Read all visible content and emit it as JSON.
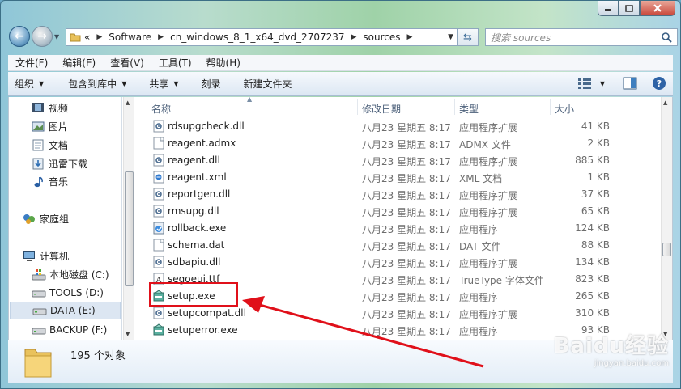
{
  "address": {
    "overflow": "«",
    "segments": [
      "Software",
      "cn_windows_8_1_x64_dvd_2707237",
      "sources"
    ]
  },
  "search": {
    "placeholder": "搜索 sources"
  },
  "menu": [
    "文件(F)",
    "编辑(E)",
    "查看(V)",
    "工具(T)",
    "帮助(H)"
  ],
  "toolbar": {
    "organize": "组织",
    "include": "包含到库中",
    "share": "共享",
    "burn": "刻录",
    "new_folder": "新建文件夹"
  },
  "nav": {
    "items": [
      {
        "label": "视频",
        "icon": "video-library-icon"
      },
      {
        "label": "图片",
        "icon": "pictures-library-icon"
      },
      {
        "label": "文档",
        "icon": "documents-library-icon"
      },
      {
        "label": "迅雷下载",
        "icon": "downloads-library-icon"
      },
      {
        "label": "音乐",
        "icon": "music-library-icon"
      },
      {
        "label": "家庭组",
        "icon": "homegroup-icon"
      },
      {
        "label": "计算机",
        "icon": "computer-icon"
      },
      {
        "label": "本地磁盘 (C:)",
        "icon": "system-drive-icon"
      },
      {
        "label": "TOOLS (D:)",
        "icon": "drive-icon"
      },
      {
        "label": "DATA (E:)",
        "icon": "drive-icon"
      },
      {
        "label": "BACKUP (F:)",
        "icon": "drive-icon"
      }
    ]
  },
  "columns": {
    "name": "名称",
    "date": "修改日期",
    "type": "类型",
    "size": "大小"
  },
  "files": [
    {
      "name": "rdsupgcheck.dll",
      "date": "八月23 星期五 8:17",
      "type": "应用程序扩展",
      "size": "41 KB",
      "icon": "dll-icon"
    },
    {
      "name": "reagent.admx",
      "date": "八月23 星期五 8:17",
      "type": "ADMX 文件",
      "size": "2 KB",
      "icon": "file-icon"
    },
    {
      "name": "reagent.dll",
      "date": "八月23 星期五 8:17",
      "type": "应用程序扩展",
      "size": "885 KB",
      "icon": "dll-icon"
    },
    {
      "name": "reagent.xml",
      "date": "八月23 星期五 8:17",
      "type": "XML 文档",
      "size": "1 KB",
      "icon": "xml-icon"
    },
    {
      "name": "reportgen.dll",
      "date": "八月23 星期五 8:17",
      "type": "应用程序扩展",
      "size": "37 KB",
      "icon": "dll-icon"
    },
    {
      "name": "rmsupg.dll",
      "date": "八月23 星期五 8:17",
      "type": "应用程序扩展",
      "size": "65 KB",
      "icon": "dll-icon"
    },
    {
      "name": "rollback.exe",
      "date": "八月23 星期五 8:17",
      "type": "应用程序",
      "size": "124 KB",
      "icon": "exe-icon"
    },
    {
      "name": "schema.dat",
      "date": "八月23 星期五 8:17",
      "type": "DAT 文件",
      "size": "88 KB",
      "icon": "file-icon"
    },
    {
      "name": "sdbapiu.dll",
      "date": "八月23 星期五 8:17",
      "type": "应用程序扩展",
      "size": "134 KB",
      "icon": "dll-icon"
    },
    {
      "name": "segoeui.ttf",
      "date": "八月23 星期五 8:17",
      "type": "TrueType 字体文件",
      "size": "823 KB",
      "icon": "font-icon"
    },
    {
      "name": "setup.exe",
      "date": "八月23 星期五 8:17",
      "type": "应用程序",
      "size": "265 KB",
      "icon": "setup-icon"
    },
    {
      "name": "setupcompat.dll",
      "date": "八月23 星期五 8:17",
      "type": "应用程序扩展",
      "size": "310 KB",
      "icon": "dll-icon"
    },
    {
      "name": "setuperror.exe",
      "date": "八月23 星期五 8:17",
      "type": "应用程序",
      "size": "93 KB",
      "icon": "setup-icon"
    }
  ],
  "details": {
    "count": "195 个对象"
  },
  "watermark": {
    "brand": "Baidu经验",
    "url": "jingyan.baidu.com"
  },
  "colors": {
    "annotation": "#e0101a",
    "accent": "#3b6b97"
  }
}
